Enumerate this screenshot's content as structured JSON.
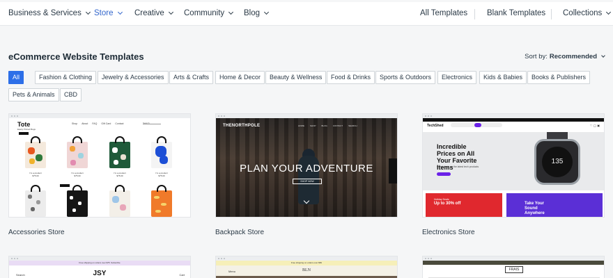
{
  "nav": {
    "left": [
      {
        "label": "Business & Services",
        "active": false
      },
      {
        "label": "Store",
        "active": true
      },
      {
        "label": "Creative",
        "active": false
      },
      {
        "label": "Community",
        "active": false
      },
      {
        "label": "Blog",
        "active": false
      }
    ],
    "right": {
      "all_templates": "All Templates",
      "blank_templates": "Blank Templates",
      "collections": "Collections"
    }
  },
  "page": {
    "title": "eCommerce Website Templates",
    "sort_label": "Sort by:",
    "sort_value": "Recommended"
  },
  "filters": [
    {
      "label": "All",
      "active": true
    },
    {
      "label": "Fashion & Clothing"
    },
    {
      "label": "Jewelry & Accessories"
    },
    {
      "label": "Arts & Crafts"
    },
    {
      "label": "Home & Decor"
    },
    {
      "label": "Beauty & Wellness"
    },
    {
      "label": "Food & Drinks"
    },
    {
      "label": "Sports & Outdoors"
    },
    {
      "label": "Electronics"
    },
    {
      "label": "Kids & Babies"
    },
    {
      "label": "Books & Publishers"
    },
    {
      "label": "Pets & Animals"
    },
    {
      "label": "CBD"
    }
  ],
  "templates": [
    {
      "name": "Accessories Store",
      "preview": {
        "logo": "Tote",
        "tagline": "Easily Printed Bags",
        "menu": [
          "Shop",
          "About",
          "FAQ",
          "Gift Card",
          "Contact"
        ],
        "search": "Search",
        "product_text": "I'm a product",
        "price": "$75.00"
      }
    },
    {
      "name": "Backpack Store",
      "preview": {
        "logo": "THENORTHPOLE",
        "menu": [
          "HOME",
          "SHOP",
          "BLOG",
          "CONTACT",
          "SEARCH"
        ],
        "headline": "PLAN YOUR ADVENTURE",
        "button": "SHOP NOW"
      }
    },
    {
      "name": "Electronics Store",
      "preview": {
        "logo": "TechShed",
        "headline": "Incredible Prices on All Your Favorite Items",
        "subtext": "Great deals on the latest tech products",
        "watch_time": "135",
        "banner_1": "Up to 30% off",
        "banner_1_tag": "Holiday Deals",
        "banner_2": "Take Your Sound Anywhere"
      }
    }
  ],
  "row2": {
    "card1": {
      "top_text": "Free shipping on orders over $75. Subscribe",
      "search": "Search",
      "logo": "JSY",
      "cart": "Cart"
    },
    "card2": {
      "top_text": "Free shipping on orders over $50",
      "left": "Menu",
      "logo": "BLN"
    },
    "card3": {
      "logo": "FRAIS"
    }
  },
  "colors": {
    "accent": "#3366cc",
    "chip_active": "#2d6fe8",
    "el_purple": "#6b21e8",
    "el_red": "#e0282e"
  }
}
